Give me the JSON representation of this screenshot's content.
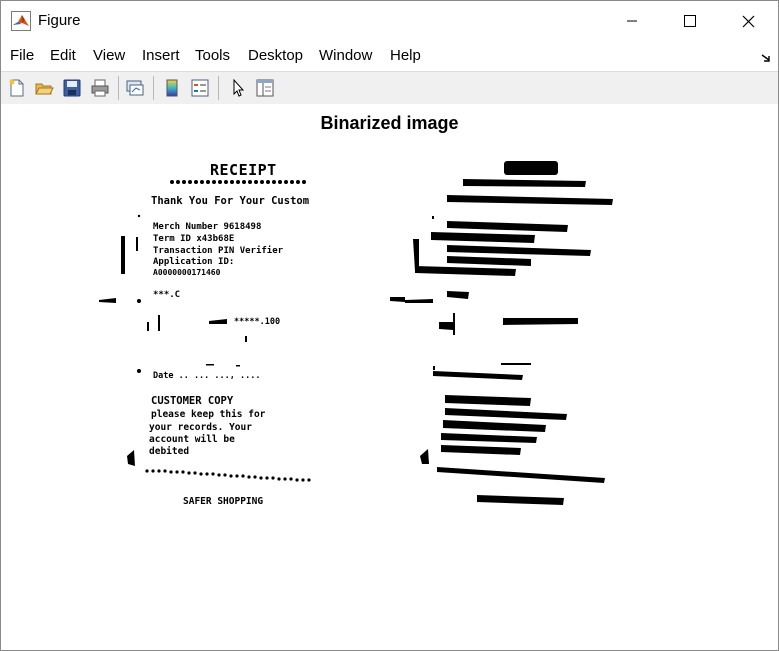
{
  "window": {
    "title": "Figure",
    "controls": {
      "minimize": "minimize-icon",
      "maximize": "maximize-icon",
      "close": "close-icon"
    }
  },
  "menu": {
    "items": [
      "File",
      "Edit",
      "View",
      "Insert",
      "Tools",
      "Desktop",
      "Window",
      "Help"
    ]
  },
  "toolbar": {
    "tools": [
      "new-figure-icon",
      "open-file-icon",
      "save-icon",
      "print-icon",
      "link-plot-icon",
      "insert-colorbar-icon",
      "insert-legend-icon",
      "edit-plot-pointer-icon",
      "property-inspector-icon"
    ]
  },
  "figure": {
    "title": "Binarized image",
    "left_image": {
      "heading": "RECEIPT",
      "lines": [
        "Thank You For Your Custom",
        "Merch Number  9618498",
        "Term ID   x43b68E",
        "Transaction  PIN Verifier",
        "Application ID:",
        "A0000000171460",
        "***.C",
        "*****.100",
        "Date .. ... ..., ....",
        "CUSTOMER COPY",
        "please keep this for",
        "your records. Your",
        "account will be",
        "debited",
        "SAFER SHOPPING"
      ]
    },
    "right_image": {
      "description_colors": {
        "ink": "#000000",
        "paper": "#ffffff"
      }
    }
  },
  "colors": {
    "toolbar_bg": "#f0f0f0",
    "window_bg": "#ffffff",
    "border": "#8a8a8a"
  }
}
